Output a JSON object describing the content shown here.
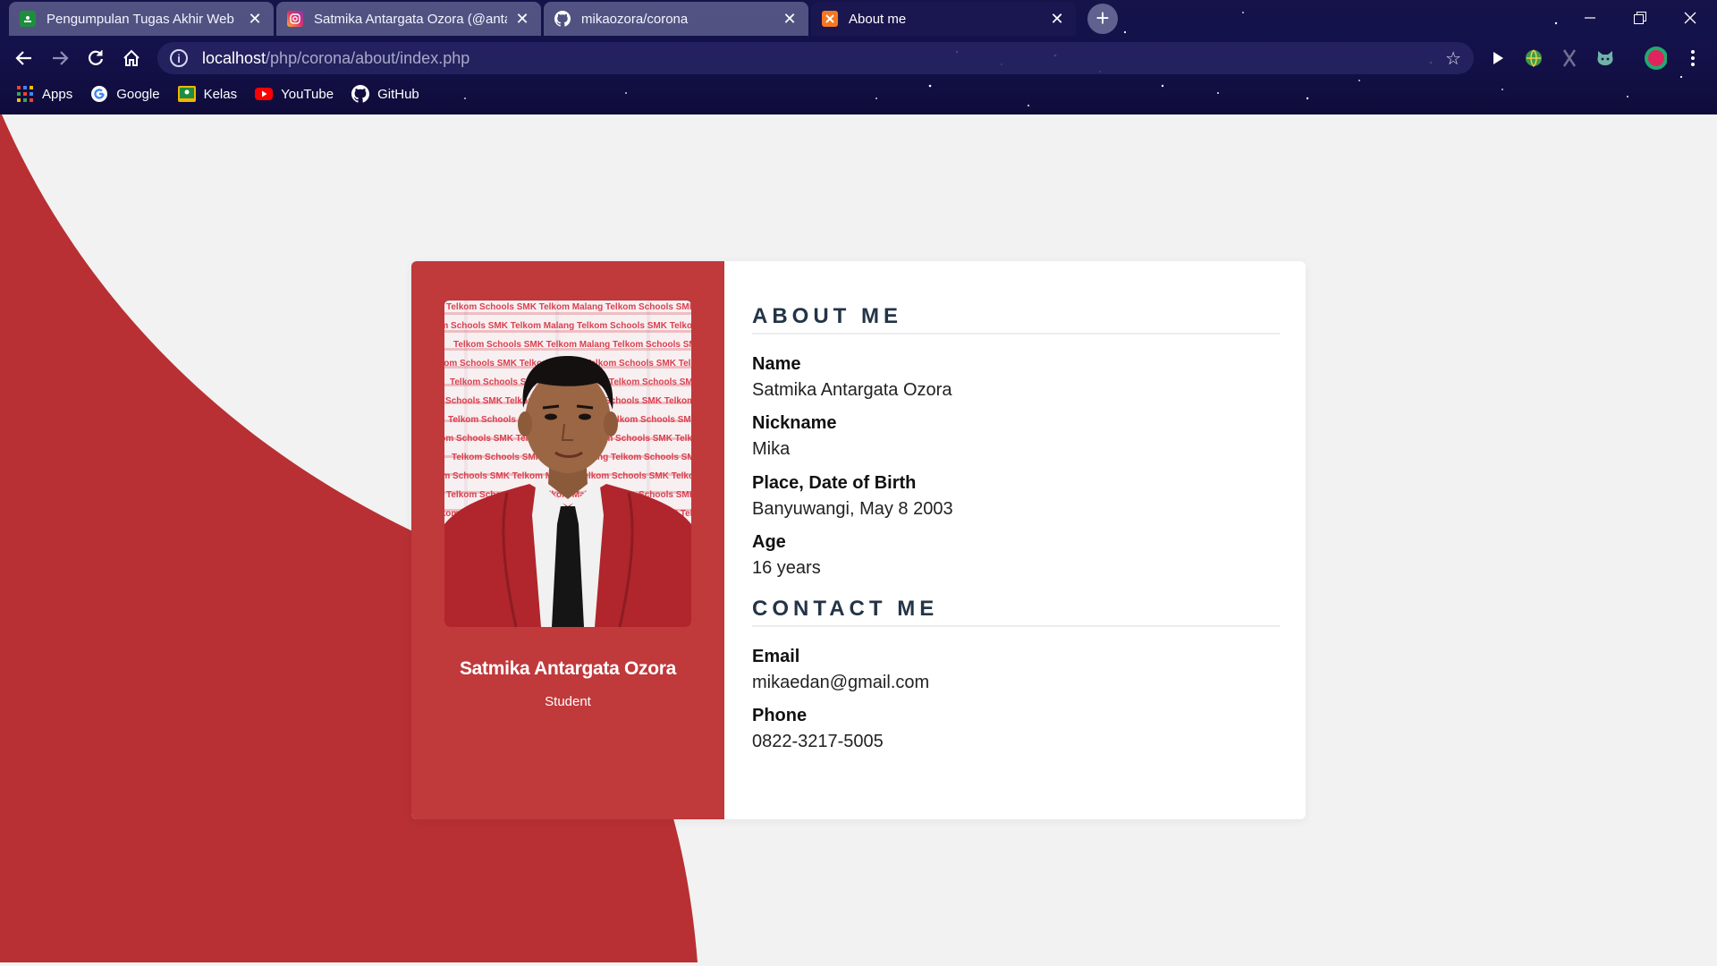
{
  "browser": {
    "tabs": [
      {
        "title": "Pengumpulan Tugas Akhir Web",
        "favicon": "google-classroom-icon",
        "active": false
      },
      {
        "title": "Satmika Antargata Ozora (@anta",
        "favicon": "instagram-icon",
        "active": false
      },
      {
        "title": "mikaozora/corona",
        "favicon": "github-icon",
        "active": false
      },
      {
        "title": "About me",
        "favicon": "xampp-icon",
        "active": true
      }
    ],
    "address": {
      "host": "localhost",
      "path": "/php/corona/about/index.php"
    },
    "bookmarks": [
      {
        "label": "Apps",
        "icon": "apps-grid-icon"
      },
      {
        "label": "Google",
        "icon": "google-icon"
      },
      {
        "label": "Kelas",
        "icon": "google-classroom-icon"
      },
      {
        "label": "YouTube",
        "icon": "youtube-icon"
      },
      {
        "label": "GitHub",
        "icon": "github-icon"
      }
    ]
  },
  "profile": {
    "name": "Satmika Antargata Ozora",
    "role": "Student"
  },
  "about": {
    "heading": "ABOUT ME",
    "fields": [
      {
        "label": "Name",
        "value": "Satmika Antargata Ozora"
      },
      {
        "label": "Nickname",
        "value": "Mika"
      },
      {
        "label": "Place, Date of Birth",
        "value": "Banyuwangi, May 8 2003"
      },
      {
        "label": "Age",
        "value": "16 years"
      }
    ]
  },
  "contact": {
    "heading": "CONTACT ME",
    "fields": [
      {
        "label": "Email",
        "value": "mikaedan@gmail.com"
      },
      {
        "label": "Phone",
        "value": "0822-3217-5005"
      }
    ]
  },
  "photo_backdrop_text": "Telkom Schools SMK Telkom Malang",
  "colors": {
    "accent_red": "#c0393b",
    "background_red": "#b83033",
    "page_bg": "#f2f2f2",
    "heading_color": "#243447"
  }
}
